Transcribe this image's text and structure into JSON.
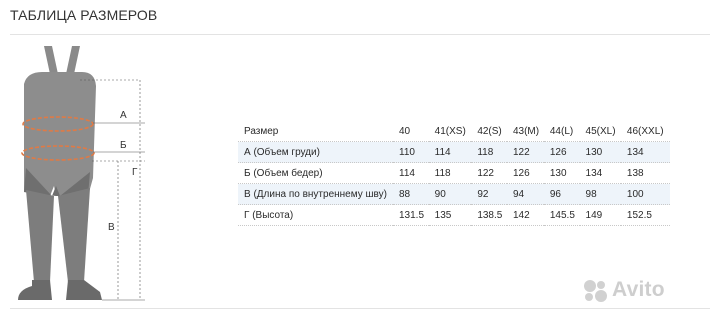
{
  "page": {
    "title": "ТАБЛИЦА РАЗМЕРОВ"
  },
  "figure": {
    "markers": {
      "a": "А",
      "b": "Б",
      "v": "В",
      "g": "Г"
    },
    "colors": {
      "body": "#888888",
      "waist": "#e07a45",
      "leader": "#555555"
    }
  },
  "table": {
    "rows": [
      {
        "label": "Размер",
        "values": [
          "40",
          "41(XS)",
          "42(S)",
          "43(M)",
          "44(L)",
          "45(XL)",
          "46(XXL)"
        ]
      },
      {
        "label": "А (Объем груди)",
        "values": [
          "110",
          "114",
          "118",
          "122",
          "126",
          "130",
          "134"
        ]
      },
      {
        "label": "Б (Объем бедер)",
        "values": [
          "114",
          "118",
          "122",
          "126",
          "130",
          "134",
          "138"
        ]
      },
      {
        "label": "В (Длина по внутреннему шву)",
        "values": [
          "88",
          "90",
          "92",
          "94",
          "96",
          "98",
          "100"
        ]
      },
      {
        "label": "Г (Высота)",
        "values": [
          "131.5",
          "135",
          "138.5",
          "142",
          "145.5",
          "149",
          "152.5"
        ]
      }
    ],
    "stripe_color": "#eef4fa"
  },
  "watermark": {
    "text": "Avito",
    "icon": "avito-logo-icon"
  }
}
